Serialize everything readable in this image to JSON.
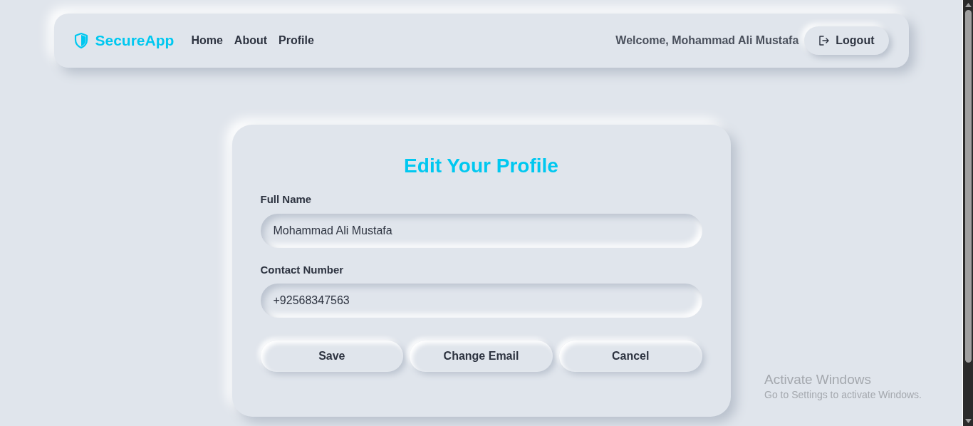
{
  "navbar": {
    "brand": "SecureApp",
    "links": [
      {
        "label": "Home"
      },
      {
        "label": "About"
      },
      {
        "label": "Profile"
      }
    ],
    "welcome": "Welcome, Mohammad Ali Mustafa",
    "logout": "Logout"
  },
  "form": {
    "title": "Edit Your Profile",
    "fields": [
      {
        "label": "Full Name",
        "value": "Mohammad Ali Mustafa"
      },
      {
        "label": "Contact Number",
        "value": "+92568347563"
      }
    ],
    "buttons": [
      "Save",
      "Change Email",
      "Cancel"
    ]
  },
  "os_notice": {
    "title": "Activate Windows",
    "text": "Go to Settings to activate Windows."
  }
}
